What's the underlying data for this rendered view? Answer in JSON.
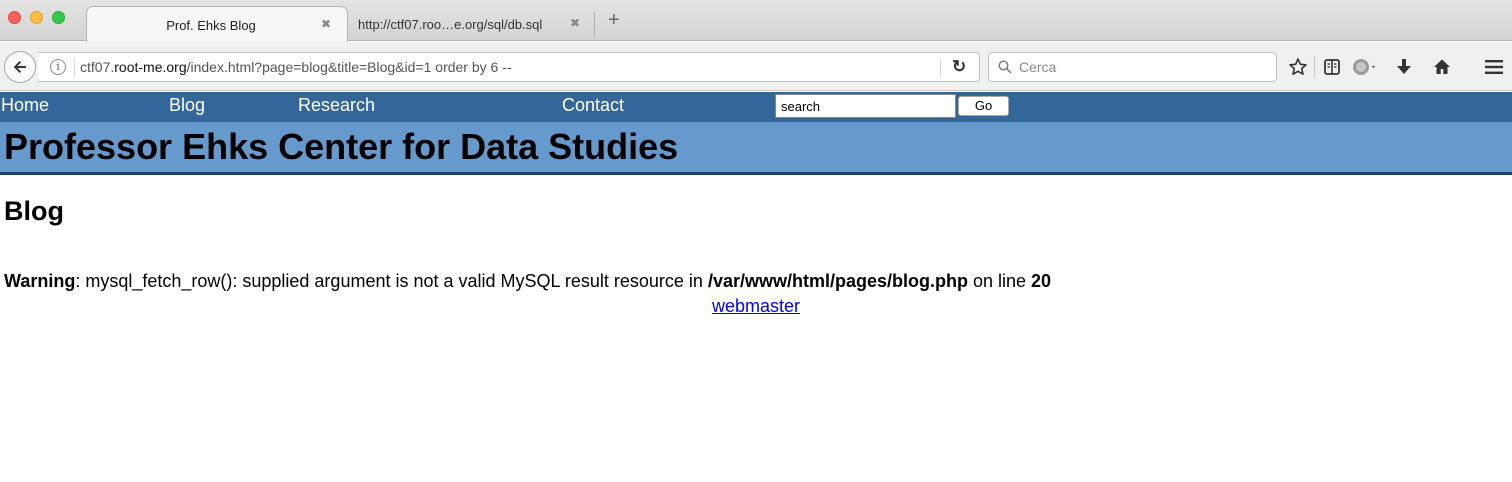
{
  "browser": {
    "tabs": [
      {
        "title": "Prof. Ehks Blog",
        "active": true
      },
      {
        "title": "http://ctf07.roo…e.org/sql/db.sql",
        "active": false
      }
    ],
    "close_glyph": "✖",
    "new_tab_glyph": "+",
    "url": {
      "prefix": "ctf07.",
      "host": "root-me.org",
      "path": "/index.html?page=blog&title=Blog&id=1 order by 6 --"
    },
    "search_placeholder": "Cerca",
    "icons": [
      "back-arrow-icon",
      "info-icon",
      "reload-icon",
      "search-icon",
      "star-icon",
      "reading-list-icon",
      "globe-icon",
      "download-icon",
      "home-icon",
      "hamburger-menu-icon"
    ]
  },
  "site": {
    "nav": [
      "Home",
      "Blog",
      "Research",
      "Contact"
    ],
    "search_value": "search",
    "go_label": "Go",
    "banner_title": "Professor Ehks Center for Data Studies",
    "page_heading": "Blog",
    "warning": {
      "label": "Warning",
      "text": ": mysql_fetch_row(): supplied argument is not a valid MySQL result resource in ",
      "file": "/var/www/html/pages/blog.php",
      "on_line": " on line ",
      "line": "20"
    },
    "footer_link": "webmaster"
  },
  "colors": {
    "nav_bg": "#336699",
    "banner_bg": "#6699cc",
    "banner_border": "#1d3e6e",
    "link": "#0000ee"
  }
}
